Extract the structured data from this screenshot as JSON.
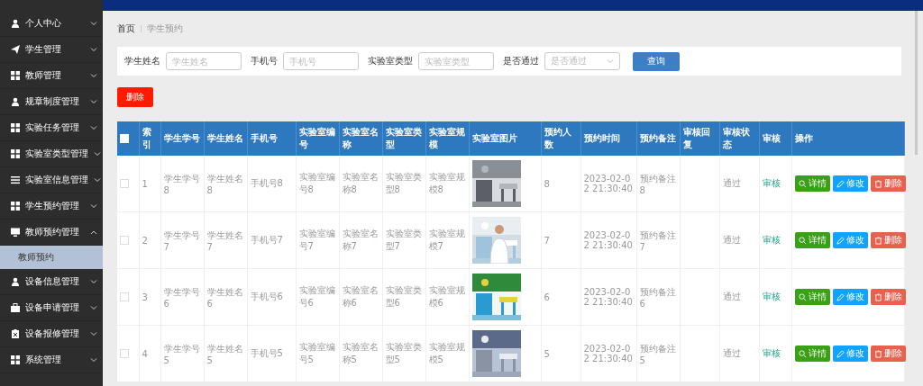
{
  "sidebar": {
    "items": [
      {
        "kind": "person",
        "label": "个人中心",
        "expanded": false
      },
      {
        "kind": "plane",
        "label": "学生管理",
        "expanded": false
      },
      {
        "kind": "grid",
        "label": "教师管理",
        "expanded": false
      },
      {
        "kind": "person",
        "label": "规章制度管理",
        "expanded": false
      },
      {
        "kind": "grid",
        "label": "实验任务管理",
        "expanded": false
      },
      {
        "kind": "grid",
        "label": "实验室类型管理",
        "expanded": false
      },
      {
        "kind": "list",
        "label": "实验室信息管理",
        "expanded": false
      },
      {
        "kind": "grid",
        "label": "学生预约管理",
        "expanded": false
      },
      {
        "kind": "monitor",
        "label": "教师预约管理",
        "expanded": true,
        "children": [
          {
            "label": "教师预约",
            "selected": true
          }
        ]
      },
      {
        "kind": "person",
        "label": "设备信息管理",
        "expanded": false
      },
      {
        "kind": "briefcase",
        "label": "设备申请管理",
        "expanded": false
      },
      {
        "kind": "clipboard",
        "label": "设备报修管理",
        "expanded": false
      },
      {
        "kind": "grid",
        "label": "系统管理",
        "expanded": false
      }
    ]
  },
  "breadcrumb": [
    "首页",
    "学生预约"
  ],
  "search": {
    "fields": [
      {
        "kind": "input",
        "label": "学生姓名",
        "placeholder": "学生姓名"
      },
      {
        "kind": "input",
        "label": "手机号",
        "placeholder": "手机号"
      },
      {
        "kind": "input",
        "label": "实验室类型",
        "placeholder": "实验室类型"
      },
      {
        "kind": "select",
        "label": "是否通过",
        "placeholder": "是否通过"
      }
    ],
    "button": "查询"
  },
  "delete_button": "删除",
  "table": {
    "select_all_checked": false,
    "columns": [
      "索引",
      "学生学号",
      "学生姓名",
      "手机号",
      "实验室编号",
      "实验室名称",
      "实验室类型",
      "实验室规模",
      "实验室图片",
      "预约人数",
      "预约时间",
      "预约备注",
      "审核回复",
      "审核状态",
      "审核",
      "操作"
    ],
    "rows": [
      {
        "checked": false,
        "cells": [
          "1",
          "学生学号8",
          "学生姓名8",
          "手机号8",
          "实验室编号8",
          "实验室名称8",
          "实验室类型8",
          "实验室规模8"
        ],
        "image": {
          "kind": "picture"
        },
        "count": "8",
        "time": "2023-02-02 21:30:40",
        "note": "预约备注8",
        "status": "通过",
        "review": "审核",
        "actions": [
          "详情",
          "修改",
          "删除"
        ]
      },
      {
        "checked": false,
        "cells": [
          "2",
          "学生学号7",
          "学生姓名7",
          "手机号7",
          "实验室编号7",
          "实验室名称7",
          "实验室类型7",
          "实验室规模7"
        ],
        "image": {
          "kind": "picture"
        },
        "count": "7",
        "time": "2023-02-02 21:30:40",
        "note": "预约备注7",
        "status": "通过",
        "review": "审核",
        "actions": [
          "详情",
          "修改",
          "删除"
        ]
      },
      {
        "checked": false,
        "cells": [
          "3",
          "学生学号6",
          "学生姓名6",
          "手机号6",
          "实验室编号6",
          "实验室名称6",
          "实验室类型6",
          "实验室规模6"
        ],
        "image": {
          "kind": "picture"
        },
        "count": "6",
        "time": "2023-02-02 21:30:40",
        "note": "预约备注6",
        "status": "通过",
        "review": "审核",
        "actions": [
          "详情",
          "修改",
          "删除"
        ]
      },
      {
        "checked": false,
        "cells": [
          "4",
          "学生学号5",
          "学生姓名5",
          "手机号5",
          "实验室编号5",
          "实验室名称5",
          "实验室类型5",
          "实验室规模5"
        ],
        "image": {
          "kind": "picture"
        },
        "count": "5",
        "time": "2023-02-02 21:30:40",
        "note": "预约备注5",
        "status": "通过",
        "review": "审核",
        "actions": [
          "详情",
          "修改",
          "删除"
        ]
      }
    ]
  }
}
